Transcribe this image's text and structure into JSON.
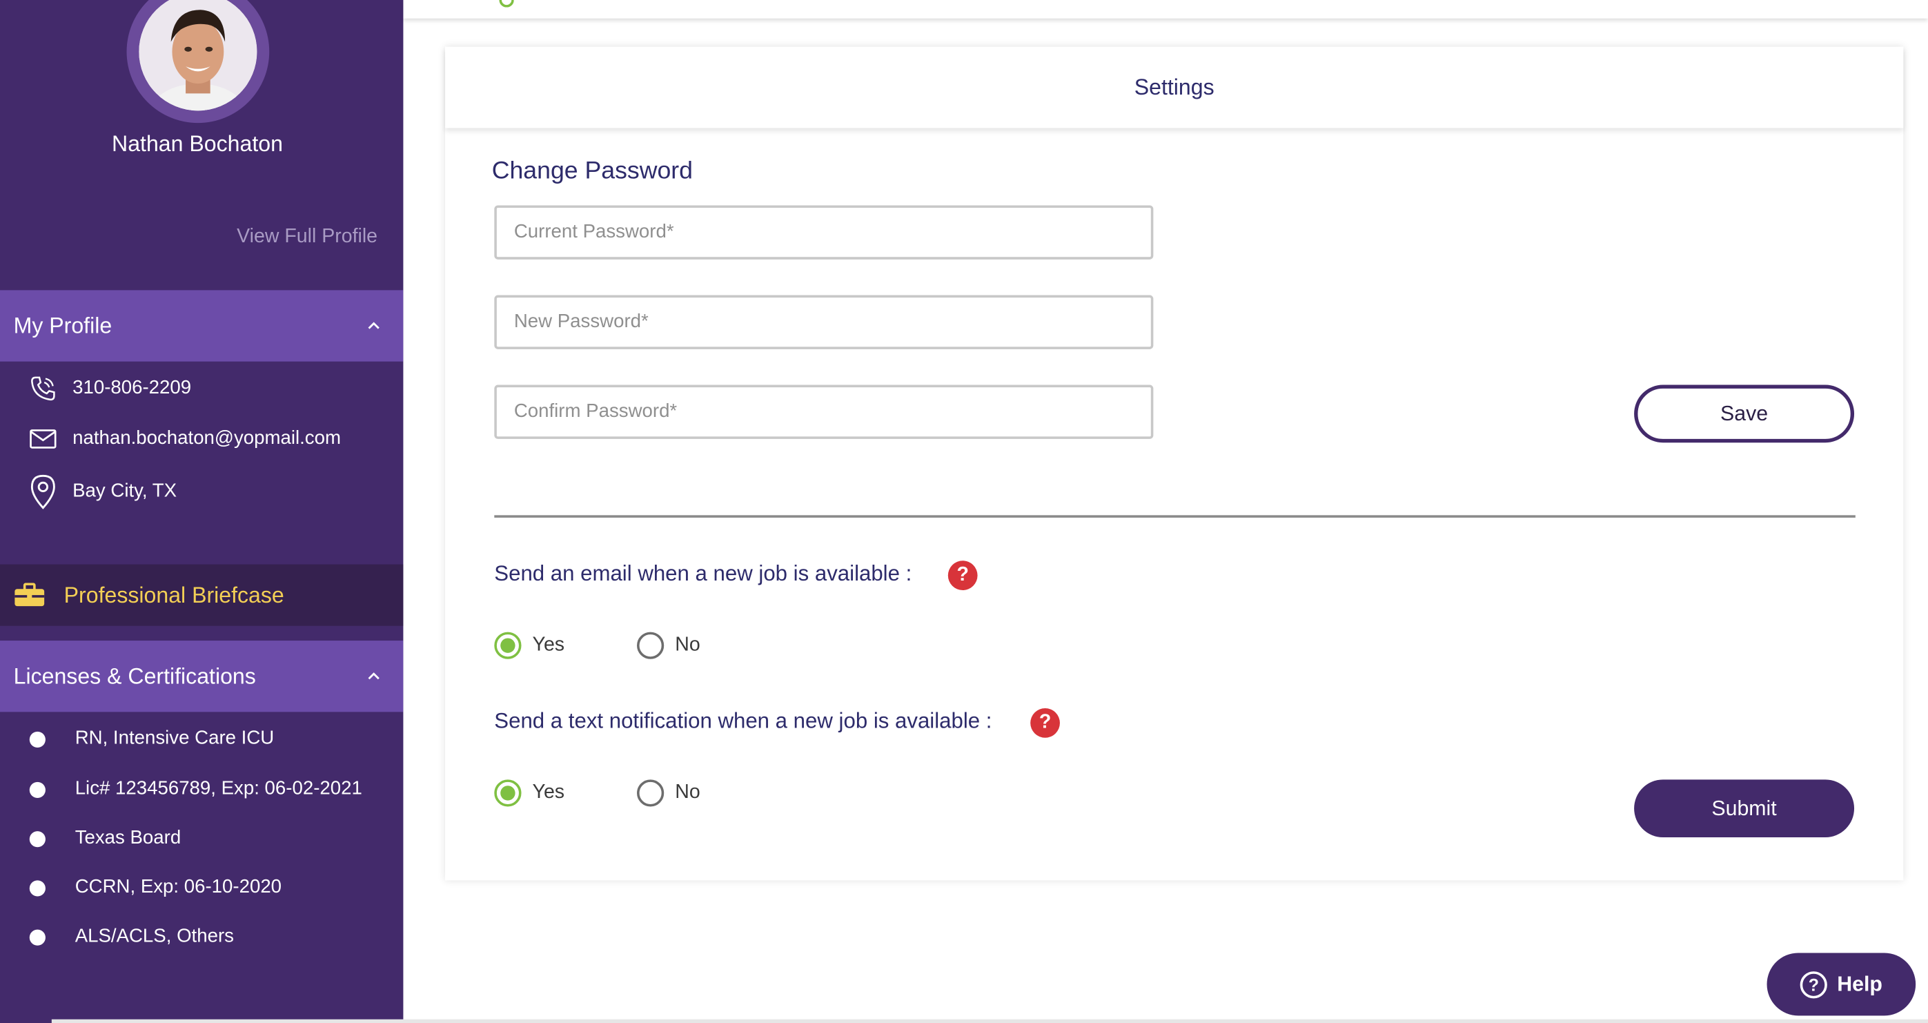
{
  "sidebar": {
    "user_name": "Nathan Bochaton",
    "view_profile": "View Full Profile",
    "my_profile": {
      "title": "My Profile",
      "phone": "310-806-2209",
      "email": "nathan.bochaton@yopmail.com",
      "location": "Bay City, TX"
    },
    "briefcase": "Professional Briefcase",
    "licenses": {
      "title": "Licenses & Certifications",
      "items": [
        "RN, Intensive Care ICU",
        "Lic# 123456789, Exp: 06-02-2021",
        "Texas Board",
        "CCRN, Exp: 06-10-2020",
        "ALS/ACLS, Others"
      ]
    }
  },
  "settings": {
    "header": "Settings",
    "change_password": {
      "title": "Change Password",
      "current_placeholder": "Current Password*",
      "new_placeholder": "New Password*",
      "confirm_placeholder": "Confirm Password*",
      "save_label": "Save"
    },
    "email_pref": {
      "question": "Send an email when a new job is available :",
      "yes": "Yes",
      "no": "No",
      "selected": "Yes"
    },
    "text_pref": {
      "question": "Send a text notification when a new job is available :",
      "yes": "Yes",
      "no": "No",
      "selected": "Yes"
    },
    "submit_label": "Submit"
  },
  "help": {
    "label": "Help"
  },
  "colors": {
    "sidebar_bg": "#432a6b",
    "section_header_bg": "#6c4ca9",
    "briefcase_bg": "#35214f",
    "briefcase_text": "#f3cf55",
    "title_text": "#2d2b6b",
    "radio_checked": "#7fc042",
    "help_icon": "#d8343a"
  },
  "icons": {
    "phone": "phone-icon",
    "email": "mail-icon",
    "location": "map-pin-icon",
    "briefcase": "briefcase-icon",
    "help": "question-icon",
    "collapse": "chevron-up-icon"
  }
}
